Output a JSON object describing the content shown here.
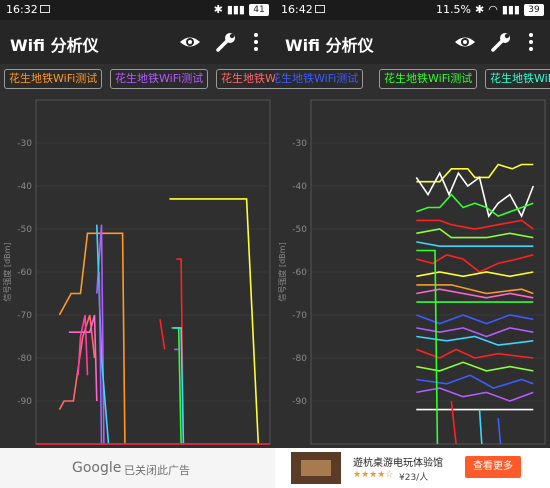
{
  "colors": {
    "orange": "#ff9a2a",
    "violet": "#b45cff",
    "salmon": "#ff6a6a",
    "blue": "#3d5cff",
    "yellow": "#ffff33",
    "white": "#ffffff",
    "green": "#33ff33",
    "cyan": "#3ad7ff",
    "pink": "#ff66cc",
    "red": "#ff2222",
    "lime": "#8cff3a",
    "teal": "#00e3b0"
  },
  "left": {
    "status": {
      "time": "16:32",
      "battery": "41"
    },
    "app_title": "Wifi 分析仪",
    "chips": [
      {
        "label": "花生地铁WiFi测试",
        "color": "#ff9a2a"
      },
      {
        "label": "花生地铁WiFi测试",
        "color": "#b45cff"
      },
      {
        "label": "花生地铁WiFi测试",
        "color": "#ff6a6a"
      }
    ],
    "y_axis_title": "信号强度 [dBm]",
    "y_ticks": [
      "-30",
      "-40",
      "-50",
      "-60",
      "-70",
      "-80",
      "-90"
    ],
    "ad": {
      "brand": "Google",
      "text": "已关闭此广告"
    }
  },
  "right": {
    "status": {
      "time": "16:42",
      "signal": "11.5%",
      "battery": "39"
    },
    "app_title": "Wifi 分析仪",
    "chips": [
      {
        "label": "花生地铁WiFi测试",
        "color": "#3d5cff"
      },
      {
        "label": "花生地铁WiFi测试",
        "color": "#33ff33"
      },
      {
        "label": "花生地铁WiFi测试",
        "color": "#33ffd0"
      }
    ],
    "y_axis_title": "信号强度 [dBm]",
    "y_ticks": [
      "-30",
      "-40",
      "-50",
      "-60",
      "-70",
      "-80",
      "-90"
    ],
    "ad": {
      "title": "遊杭桌游电玩体验馆",
      "stars": "★★★★☆",
      "price": "¥23/人",
      "button": "查看更多"
    }
  },
  "chart_data": [
    {
      "type": "line",
      "ylim": [
        -100,
        -20
      ],
      "ylabel": "信号强度 [dBm]",
      "yticks": [
        -30,
        -40,
        -50,
        -60,
        -70,
        -80,
        -90
      ],
      "series": [
        {
          "color": "#ff9a2a",
          "points": [
            [
              0.1,
              -70
            ],
            [
              0.15,
              -65
            ],
            [
              0.19,
              -65
            ],
            [
              0.22,
              -51
            ],
            [
              0.37,
              -51
            ],
            [
              0.38,
              -100
            ]
          ]
        },
        {
          "color": "#b45cff",
          "points": [
            [
              0.26,
              -65
            ],
            [
              0.28,
              -49
            ],
            [
              0.29,
              -100
            ]
          ]
        },
        {
          "color": "#ff6a6a",
          "points": [
            [
              0.1,
              -92
            ],
            [
              0.12,
              -90
            ],
            [
              0.16,
              -90
            ],
            [
              0.2,
              -75
            ],
            [
              0.23,
              -70
            ],
            [
              0.25,
              -80
            ]
          ]
        },
        {
          "color": "#ff66cc",
          "points": [
            [
              0.14,
              -74
            ],
            [
              0.23,
              -74
            ],
            [
              0.25,
              -70
            ],
            [
              0.26,
              -90
            ]
          ]
        },
        {
          "color": "#ff3fa8",
          "points": [
            [
              0.18,
              -84
            ],
            [
              0.19,
              -75
            ],
            [
              0.21,
              -70
            ],
            [
              0.22,
              -84
            ]
          ]
        },
        {
          "color": "#3ad7ff",
          "points": [
            [
              0.26,
              -49
            ],
            [
              0.28,
              -80
            ],
            [
              0.31,
              -100
            ]
          ]
        },
        {
          "color": "#9a6bff",
          "points": [
            [
              0.27,
              -60
            ],
            [
              0.28,
              -100
            ]
          ]
        },
        {
          "color": "#ff2222",
          "points": [
            [
              0.6,
              -57
            ],
            [
              0.62,
              -57
            ],
            [
              0.63,
              -100
            ]
          ]
        },
        {
          "color": "#ff2222",
          "points": [
            [
              0.53,
              -71
            ],
            [
              0.55,
              -78
            ]
          ]
        },
        {
          "color": "#33ff33",
          "points": [
            [
              0.58,
              -73
            ],
            [
              0.61,
              -73
            ],
            [
              0.62,
              -100
            ]
          ]
        },
        {
          "color": "#3ad7ff",
          "points": [
            [
              0.59,
              -73
            ],
            [
              0.62,
              -73
            ],
            [
              0.63,
              -100
            ]
          ]
        },
        {
          "color": "#a05cff",
          "points": [
            [
              0.59,
              -78
            ],
            [
              0.61,
              -78
            ]
          ]
        },
        {
          "color": "#ffff33",
          "points": [
            [
              0.57,
              -43
            ],
            [
              0.9,
              -43
            ],
            [
              0.95,
              -100
            ]
          ]
        },
        {
          "color": "#3d5cff",
          "points": [
            [
              0.0,
              -100
            ],
            [
              1.0,
              -100
            ]
          ]
        },
        {
          "color": "#ff2222",
          "points": [
            [
              0.0,
              -100
            ],
            [
              1.0,
              -100
            ]
          ]
        }
      ]
    },
    {
      "type": "line",
      "ylim": [
        -100,
        -20
      ],
      "ylabel": "信号强度 [dBm]",
      "yticks": [
        -30,
        -40,
        -50,
        -60,
        -70,
        -80,
        -90
      ],
      "series": [
        {
          "color": "#ffff33",
          "points": [
            [
              0.45,
              -39
            ],
            [
              0.55,
              -39
            ],
            [
              0.6,
              -36
            ],
            [
              0.67,
              -36
            ],
            [
              0.7,
              -38
            ],
            [
              0.76,
              -38
            ],
            [
              0.8,
              -35
            ],
            [
              0.86,
              -36
            ],
            [
              0.9,
              -35
            ],
            [
              0.95,
              -35
            ]
          ]
        },
        {
          "color": "#ffffff",
          "points": [
            [
              0.45,
              -38
            ],
            [
              0.5,
              -42
            ],
            [
              0.55,
              -37
            ],
            [
              0.59,
              -42
            ],
            [
              0.63,
              -37
            ],
            [
              0.67,
              -40
            ],
            [
              0.72,
              -38
            ],
            [
              0.76,
              -47
            ],
            [
              0.8,
              -44
            ],
            [
              0.85,
              -42
            ],
            [
              0.9,
              -47
            ],
            [
              0.95,
              -40
            ]
          ]
        },
        {
          "color": "#33ff33",
          "points": [
            [
              0.45,
              -46
            ],
            [
              0.5,
              -45
            ],
            [
              0.55,
              -45
            ],
            [
              0.6,
              -42
            ],
            [
              0.65,
              -45
            ],
            [
              0.7,
              -44
            ],
            [
              0.75,
              -45
            ],
            [
              0.8,
              -47
            ],
            [
              0.9,
              -45
            ],
            [
              0.95,
              -44
            ]
          ]
        },
        {
          "color": "#ff2222",
          "points": [
            [
              0.45,
              -48
            ],
            [
              0.55,
              -48
            ],
            [
              0.6,
              -49
            ],
            [
              0.7,
              -50
            ],
            [
              0.8,
              -49
            ],
            [
              0.9,
              -48
            ],
            [
              0.95,
              -50
            ]
          ]
        },
        {
          "color": "#8cff3a",
          "points": [
            [
              0.45,
              -51
            ],
            [
              0.55,
              -50
            ],
            [
              0.6,
              -52
            ],
            [
              0.75,
              -52
            ],
            [
              0.85,
              -51
            ],
            [
              0.95,
              -52
            ]
          ]
        },
        {
          "color": "#3ad7ff",
          "points": [
            [
              0.45,
              -53
            ],
            [
              0.55,
              -54
            ],
            [
              0.65,
              -54
            ],
            [
              0.8,
              -54
            ],
            [
              0.95,
              -54
            ]
          ]
        },
        {
          "color": "#ff2222",
          "points": [
            [
              0.45,
              -57
            ],
            [
              0.52,
              -58
            ],
            [
              0.58,
              -56
            ],
            [
              0.65,
              -57
            ],
            [
              0.72,
              -60
            ],
            [
              0.8,
              -58
            ],
            [
              0.88,
              -57
            ],
            [
              0.95,
              -56
            ]
          ]
        },
        {
          "color": "#ffff33",
          "points": [
            [
              0.45,
              -61
            ],
            [
              0.55,
              -60
            ],
            [
              0.65,
              -61
            ],
            [
              0.75,
              -60
            ],
            [
              0.85,
              -61
            ],
            [
              0.95,
              -60
            ]
          ]
        },
        {
          "color": "#ff66cc",
          "points": [
            [
              0.45,
              -65
            ],
            [
              0.55,
              -64
            ],
            [
              0.65,
              -65
            ],
            [
              0.75,
              -66
            ],
            [
              0.85,
              -65
            ],
            [
              0.95,
              -66
            ]
          ]
        },
        {
          "color": "#33ff33",
          "points": [
            [
              0.45,
              -67
            ],
            [
              0.55,
              -67
            ],
            [
              0.65,
              -67
            ],
            [
              0.75,
              -67
            ],
            [
              0.85,
              -67
            ],
            [
              0.95,
              -67
            ]
          ]
        },
        {
          "color": "#ff9a2a",
          "points": [
            [
              0.45,
              -63
            ],
            [
              0.6,
              -63
            ],
            [
              0.75,
              -65
            ],
            [
              0.9,
              -64
            ],
            [
              0.95,
              -65
            ]
          ]
        },
        {
          "color": "#3d5cff",
          "points": [
            [
              0.45,
              -70
            ],
            [
              0.55,
              -72
            ],
            [
              0.65,
              -70
            ],
            [
              0.75,
              -72
            ],
            [
              0.85,
              -70
            ],
            [
              0.95,
              -71
            ]
          ]
        },
        {
          "color": "#b45cff",
          "points": [
            [
              0.45,
              -73
            ],
            [
              0.55,
              -74
            ],
            [
              0.65,
              -73
            ],
            [
              0.75,
              -75
            ],
            [
              0.85,
              -73
            ],
            [
              0.95,
              -74
            ]
          ]
        },
        {
          "color": "#3ad7ff",
          "points": [
            [
              0.45,
              -75
            ],
            [
              0.58,
              -76
            ],
            [
              0.7,
              -75
            ],
            [
              0.8,
              -77
            ],
            [
              0.95,
              -76
            ]
          ]
        },
        {
          "color": "#ff2222",
          "points": [
            [
              0.45,
              -78
            ],
            [
              0.55,
              -80
            ],
            [
              0.62,
              -78
            ],
            [
              0.7,
              -80
            ],
            [
              0.8,
              -79
            ],
            [
              0.95,
              -80
            ]
          ]
        },
        {
          "color": "#8cff3a",
          "points": [
            [
              0.45,
              -82
            ],
            [
              0.55,
              -83
            ],
            [
              0.65,
              -81
            ],
            [
              0.75,
              -83
            ],
            [
              0.85,
              -82
            ],
            [
              0.95,
              -83
            ]
          ]
        },
        {
          "color": "#3d5cff",
          "points": [
            [
              0.45,
              -85
            ],
            [
              0.58,
              -86
            ],
            [
              0.68,
              -84
            ],
            [
              0.78,
              -87
            ],
            [
              0.9,
              -85
            ],
            [
              0.95,
              -86
            ]
          ]
        },
        {
          "color": "#b45cff",
          "points": [
            [
              0.45,
              -88
            ],
            [
              0.55,
              -87
            ],
            [
              0.65,
              -89
            ],
            [
              0.75,
              -88
            ],
            [
              0.85,
              -90
            ],
            [
              0.95,
              -88
            ]
          ]
        },
        {
          "color": "#ffffff",
          "points": [
            [
              0.45,
              -92
            ],
            [
              0.95,
              -92
            ]
          ]
        },
        {
          "color": "#33ff33",
          "points": [
            [
              0.45,
              -55
            ],
            [
              0.53,
              -55
            ],
            [
              0.54,
              -100
            ]
          ]
        },
        {
          "color": "#ff2222",
          "points": [
            [
              0.6,
              -90
            ],
            [
              0.62,
              -100
            ]
          ]
        },
        {
          "color": "#3ad7ff",
          "points": [
            [
              0.72,
              -92
            ],
            [
              0.73,
              -100
            ]
          ]
        },
        {
          "color": "#3d5cff",
          "points": [
            [
              0.8,
              -94
            ],
            [
              0.81,
              -100
            ]
          ]
        }
      ]
    }
  ]
}
